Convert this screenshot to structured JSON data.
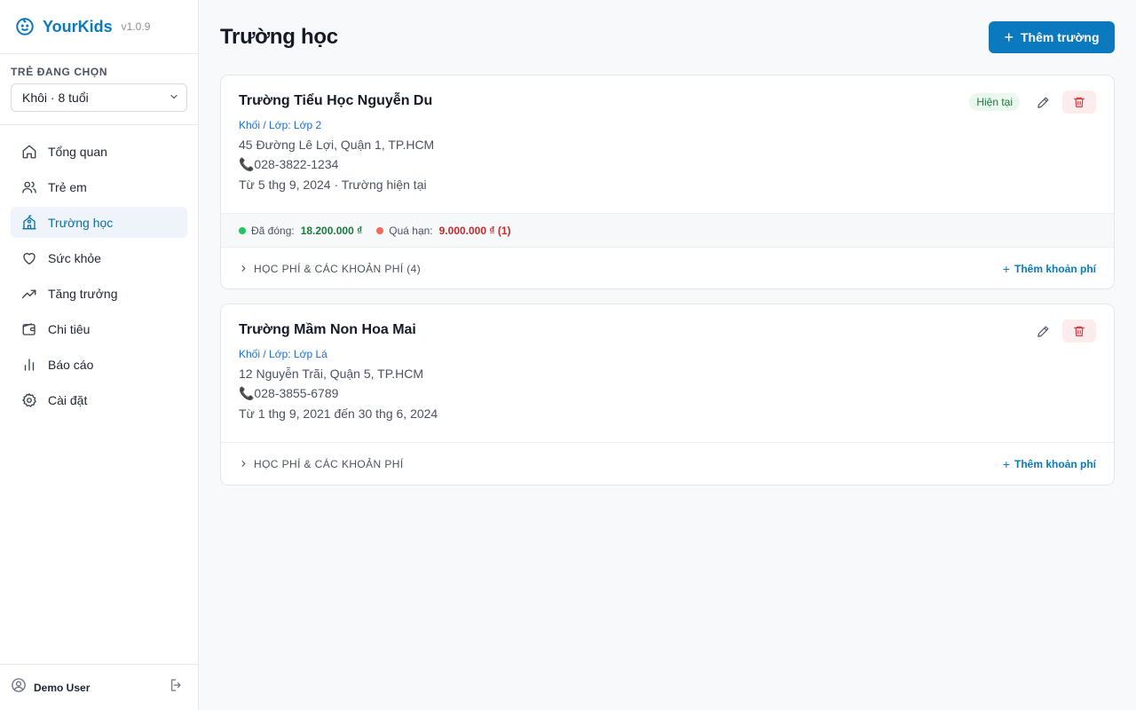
{
  "app": {
    "name": "YourKids",
    "version": "v1.0.9"
  },
  "child_section": {
    "label": "TRẺ ĐANG CHỌN",
    "selected": "Khôi · 8 tuổi"
  },
  "nav": [
    {
      "label": "Tổng quan",
      "icon": "home-icon",
      "active": false
    },
    {
      "label": "Trẻ em",
      "icon": "users-icon",
      "active": false
    },
    {
      "label": "Trường học",
      "icon": "school-icon",
      "active": true
    },
    {
      "label": "Sức khỏe",
      "icon": "heart-icon",
      "active": false
    },
    {
      "label": "Tăng trưởng",
      "icon": "trending-up-icon",
      "active": false
    },
    {
      "label": "Chi tiêu",
      "icon": "wallet-icon",
      "active": false
    },
    {
      "label": "Báo cáo",
      "icon": "bar-chart-icon",
      "active": false
    },
    {
      "label": "Cài đặt",
      "icon": "gear-icon",
      "active": false
    }
  ],
  "user": {
    "name": "Demo User"
  },
  "page": {
    "title": "Trường học",
    "add_button": "Thêm trường"
  },
  "schools": [
    {
      "name": "Trường Tiểu Học Nguyễn Du",
      "grade": "Khối / Lớp: Lớp 2",
      "address": "45 Đường Lê Lợi, Quận 1, TP.HCM",
      "phone": "📞028-3822-1234",
      "period": "Từ 5 thg 9, 2024 · Trường hiện tại",
      "badge": "Hiện tại",
      "paid_label": "Đã đóng:",
      "paid_value": "18.200.000 ₫",
      "due_label": "Quá hạn:",
      "due_value": "9.000.000 ₫ (1)",
      "fees_title": "HỌC PHÍ & CÁC KHOẢN PHÍ (4)",
      "add_fee": "Thêm khoản phí"
    },
    {
      "name": "Trường Mầm Non Hoa Mai",
      "grade": "Khối / Lớp: Lớp Lá",
      "address": "12 Nguyễn Trãi, Quận 5, TP.HCM",
      "phone": "📞028-3855-6789",
      "period": "Từ 1 thg 9, 2021 đến 30 thg 6, 2024",
      "fees_title": "HỌC PHÍ & CÁC KHOẢN PHÍ",
      "add_fee": "Thêm khoản phí"
    }
  ],
  "colors": {
    "brand": "#0a79bd",
    "paid": "#1b7a3e",
    "overdue": "#c42b2b",
    "paid_dot": "#22c55e",
    "due_dot": "#f06b5e"
  }
}
